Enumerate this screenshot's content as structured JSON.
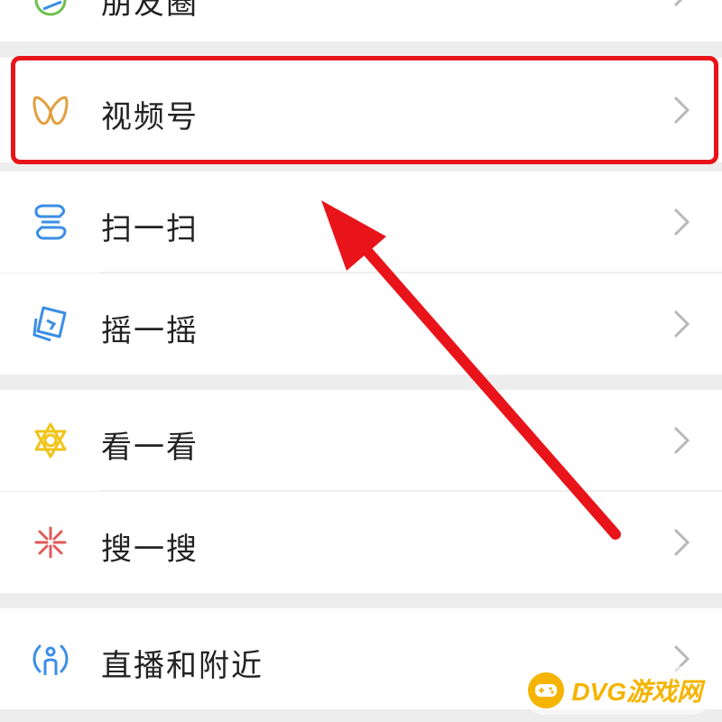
{
  "menu": {
    "items": [
      {
        "label": "朋友圈",
        "icon": "moments-icon"
      },
      {
        "label": "视频号",
        "icon": "channels-icon"
      },
      {
        "label": "扫一扫",
        "icon": "scan-icon"
      },
      {
        "label": "摇一摇",
        "icon": "shake-icon"
      },
      {
        "label": "看一看",
        "icon": "top-stories-icon"
      },
      {
        "label": "搜一搜",
        "icon": "search-icon"
      },
      {
        "label": "直播和附近",
        "icon": "live-nearby-icon"
      }
    ]
  },
  "annotation": {
    "highlighted_item": "视频号",
    "highlight_color": "#e8141a"
  },
  "watermark": {
    "text": "DVG游戏网"
  },
  "colors": {
    "channels": "#e0a040",
    "scan": "#3a8ee6",
    "shake": "#3a8ee6",
    "top_stories": "#f0c419",
    "search": "#e05a5a",
    "live_nearby": "#3a8ee6",
    "chevron": "#b8b8b8",
    "background": "#ededed"
  }
}
